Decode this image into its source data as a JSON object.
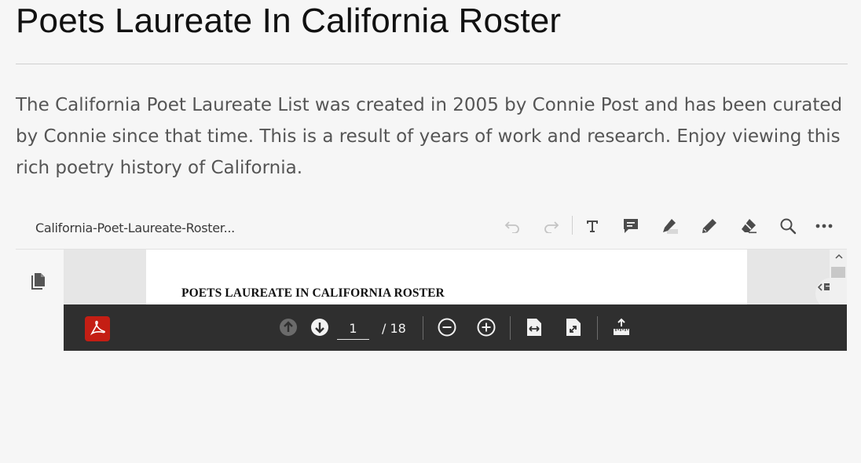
{
  "page": {
    "title": "Poets Laureate In California Roster",
    "intro": "The California Poet Laureate List was created in 2005 by Connie Post and has been curated by Connie since that time. This is a result of years of work and research. Enjoy viewing this rich poetry history of California."
  },
  "viewer": {
    "file_name": "California-Poet-Laureate-Roster...",
    "toolbar": [
      "undo-icon",
      "redo-icon",
      "add-text-icon",
      "comment-icon",
      "highlight-icon",
      "draw-icon",
      "eraser-icon",
      "search-icon",
      "more-options-icon"
    ],
    "left_rail": [
      "page-thumbnails-icon"
    ],
    "document": {
      "heading": "POETS LAUREATE IN CALIFORNIA ROSTER"
    },
    "bottom_bar": {
      "current_page": "1",
      "total_pages": "/ 18",
      "controls": [
        "previous-page-icon",
        "next-page-icon",
        "zoom-out-icon",
        "zoom-in-icon",
        "fit-width-icon",
        "fit-page-icon",
        "full-screen-icon"
      ]
    },
    "colors": {
      "acrobat_red": "#c41e14",
      "bottom_bar_bg": "#2f2f2f",
      "page_bg": "#f6f6f6"
    }
  }
}
